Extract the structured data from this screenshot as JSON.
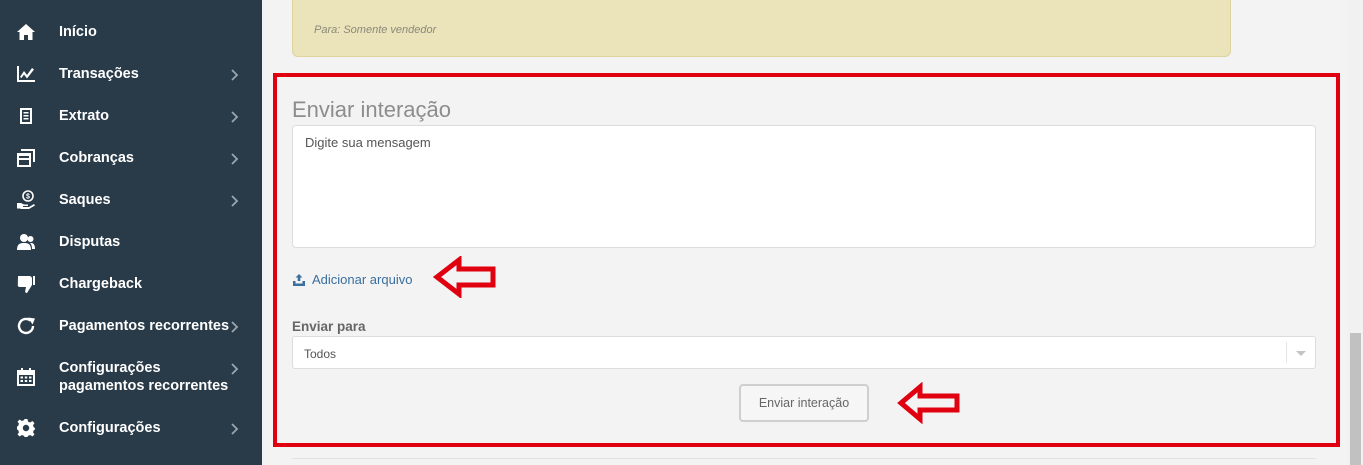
{
  "sidebar": {
    "items": [
      {
        "label": "Início",
        "icon": "home-icon",
        "chevron": false
      },
      {
        "label": "Transações",
        "icon": "line-chart-icon",
        "chevron": true
      },
      {
        "label": "Extrato",
        "icon": "document-icon",
        "chevron": true
      },
      {
        "label": "Cobranças",
        "icon": "invoice-icon",
        "chevron": true
      },
      {
        "label": "Saques",
        "icon": "money-hand-icon",
        "chevron": true
      },
      {
        "label": "Disputas",
        "icon": "users-icon",
        "chevron": false
      },
      {
        "label": "Chargeback",
        "icon": "thumbs-down-icon",
        "chevron": false
      },
      {
        "label": "Pagamentos recorrentes",
        "icon": "refresh-icon",
        "chevron": true
      },
      {
        "label": "Configurações\npagamentos recorrentes",
        "icon": "calendar-icon",
        "chevron": true
      },
      {
        "label": "Configurações",
        "icon": "gear-icon",
        "chevron": true
      }
    ]
  },
  "note": {
    "text": "Para: Somente vendedor"
  },
  "form": {
    "title": "Enviar interação",
    "message_placeholder": "Digite sua mensagem",
    "attach_label": "Adicionar arquivo",
    "send_to_label": "Enviar para",
    "send_to_value": "Todos",
    "submit_label": "Enviar interação"
  },
  "colors": {
    "sidebar_bg": "#293a48",
    "highlight": "#e0000f",
    "link": "#3a6f9e",
    "note_bg": "#ebe3b9"
  }
}
